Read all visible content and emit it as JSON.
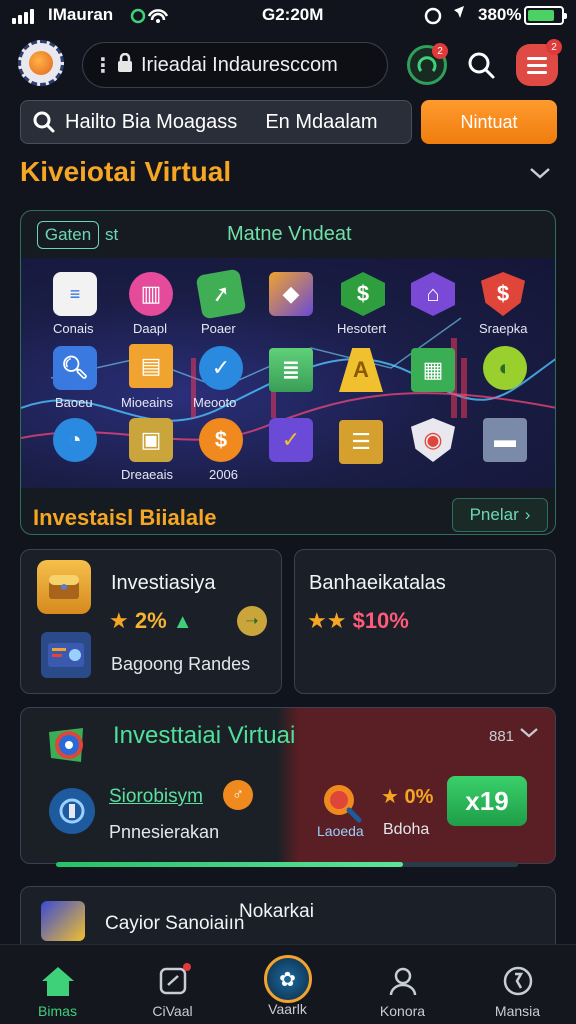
{
  "status_bar": {
    "carrier": "IMauran",
    "time": "G2:20M",
    "battery": "380%"
  },
  "browser": {
    "url": "Irieadai Indauresccom",
    "notif_badge": "2",
    "menu_badge": "2"
  },
  "search": {
    "query_part1": "Hailto Bia Moagass",
    "query_part2": "En Mdaalam",
    "cta_label": "Nintuat"
  },
  "section": {
    "title": "Kiveiotai Virtual"
  },
  "main_card": {
    "tab_label": "Gaten",
    "tab_suffix": "st",
    "title": "Matne Vndeat",
    "icons": [
      {
        "label": "Conais"
      },
      {
        "label": "Daapl"
      },
      {
        "label": "Poaer"
      },
      {
        "label": ""
      },
      {
        "label": "Hesotert"
      },
      {
        "label": ""
      },
      {
        "label": "Sraepka"
      },
      {
        "label": "Baoeu"
      },
      {
        "label": "Mioeains"
      },
      {
        "label": "Meooto"
      },
      {
        "label": "Dreaeais"
      },
      {
        "label": "2006"
      }
    ],
    "footer_title": "Investaisl Biialale",
    "footer_btn": "Pnelar"
  },
  "card_left": {
    "title": "Investiasiya",
    "stat": "2%",
    "caption": "Bagoong Randes"
  },
  "card_right": {
    "title": "Banhaeikatalas",
    "stat": "$10%"
  },
  "virtual_card": {
    "title": "Investtaiai Virtuai",
    "meta": "881",
    "sub1": "Siorobisym",
    "sub2": "Pnnesierakan",
    "right_label1": "Laoeda",
    "right_label2": "Bdoha",
    "right_stat": "0%",
    "x_badge": "x19",
    "progress": 0.75
  },
  "partial_card": {
    "title": "Cayior Sanoiaiın",
    "title_right": "Nokarkai"
  },
  "nav": {
    "items": [
      {
        "label": "Bimas"
      },
      {
        "label": "CiVaal"
      },
      {
        "label": "Vaarlk"
      },
      {
        "label": "Konora"
      },
      {
        "label": "Mansia"
      }
    ]
  }
}
